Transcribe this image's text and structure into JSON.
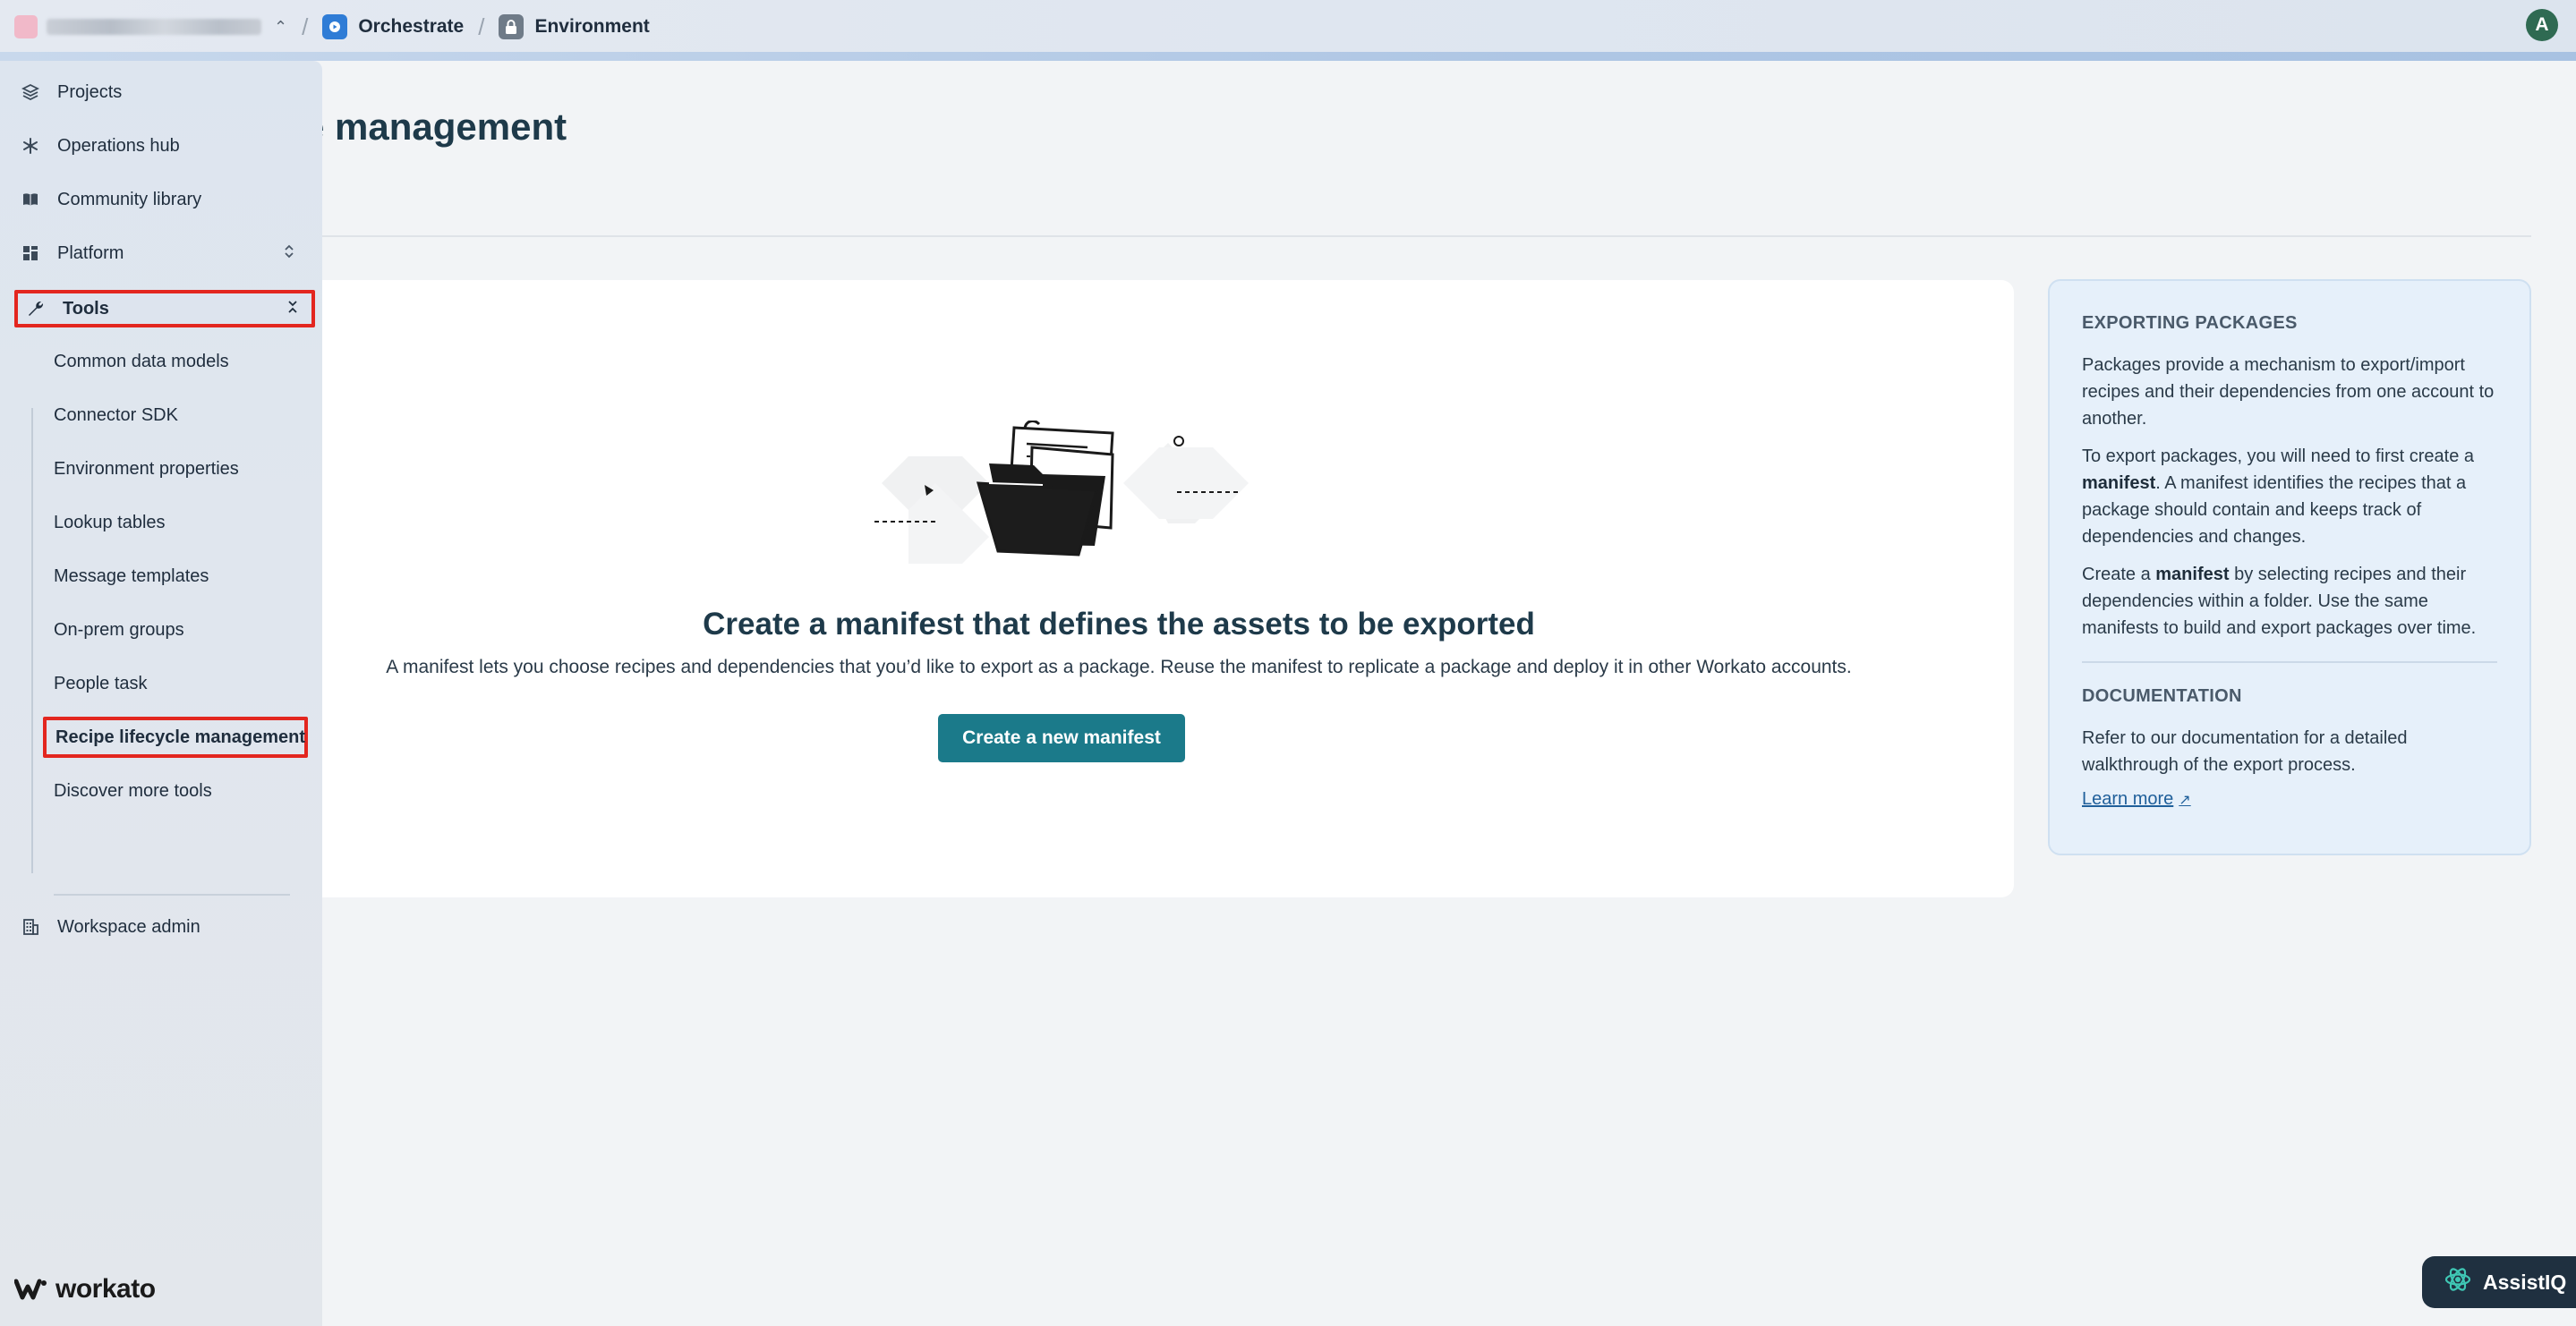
{
  "topbar": {
    "breadcrumb": [
      {
        "label": "Orchestrate",
        "icon": "orchestrate-icon"
      },
      {
        "label": "Environment",
        "icon": "lock-icon"
      }
    ],
    "user_initial": "A"
  },
  "page": {
    "title": "cle management"
  },
  "empty_state": {
    "heading": "Create a manifest that defines the assets to be exported",
    "description": "A manifest lets you choose recipes and dependencies that you’d like to export as a package. Reuse the manifest to replicate a package and deploy it in other Workato accounts.",
    "button_label": "Create a new manifest"
  },
  "info_panel": {
    "exporting_heading": "EXPORTING PACKAGES",
    "para1": "Packages provide a mechanism to export/import recipes and their dependencies from one account to another.",
    "para2_a": "To export packages, you will need to first create a ",
    "para2_bold": "manifest",
    "para2_b": ". A manifest identifies the recipes that a package should contain and keeps track of dependencies and changes.",
    "para3_a": "Create a ",
    "para3_bold": "manifest",
    "para3_b": " by selecting recipes and their dependencies within a folder. Use the same manifests to build and export packages over time.",
    "doc_heading": "DOCUMENTATION",
    "doc_text": "Refer to our documentation for a detailed walkthrough of the export process.",
    "learn_more": "Learn more"
  },
  "sidebar": {
    "items": [
      {
        "label": "Projects",
        "icon": "layers-icon"
      },
      {
        "label": "Operations hub",
        "icon": "snowflake-icon"
      },
      {
        "label": "Community library",
        "icon": "book-icon"
      },
      {
        "label": "Platform",
        "icon": "grid-icon"
      },
      {
        "label": "Tools",
        "icon": "wrench-icon"
      }
    ],
    "tools_subitems": [
      "Common data models",
      "Connector SDK",
      "Environment properties",
      "Lookup tables",
      "Message templates",
      "On-prem groups",
      "People task",
      "Recipe lifecycle management",
      "Discover more tools"
    ],
    "workspace_admin": "Workspace admin",
    "brand": "workato"
  },
  "assist": {
    "label": "AssistIQ"
  },
  "colors": {
    "primary_button": "#1b7a8a",
    "highlight_border": "#e3261f",
    "info_panel_bg": "#e6f0fa"
  }
}
